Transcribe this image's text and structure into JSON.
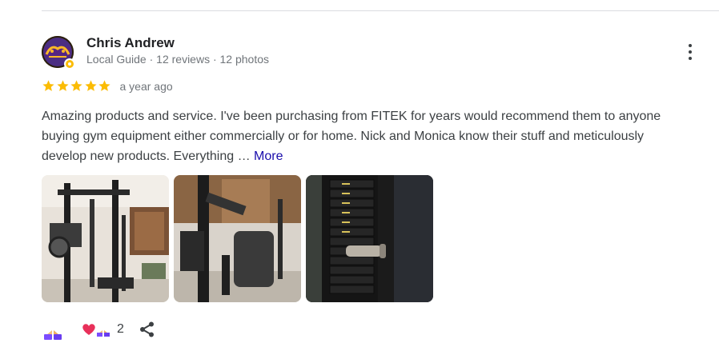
{
  "reviewer": {
    "name": "Chris Andrew",
    "meta": "Local Guide · 12 reviews · 12 photos"
  },
  "rating": {
    "stars": 5,
    "date": "a year ago"
  },
  "review": {
    "text": "Amazing products and service. I've been purchasing from FITEK for years would recommend them to anyone buying gym equipment either commercially or for home. Nick and Monica know their stuff and meticulously develop new products. Everything …",
    "more_label": "More"
  },
  "photos": [
    {
      "icon": "gym-rack-photo"
    },
    {
      "icon": "pad-machine-photo"
    },
    {
      "icon": "weight-stack-photo"
    }
  ],
  "reactions": {
    "count": "2"
  },
  "colors": {
    "star": "#fbbc04",
    "link": "#1a0dab",
    "meta": "#70757a",
    "body_text": "#3c4043",
    "avatar_badge": "#fbbc04"
  }
}
